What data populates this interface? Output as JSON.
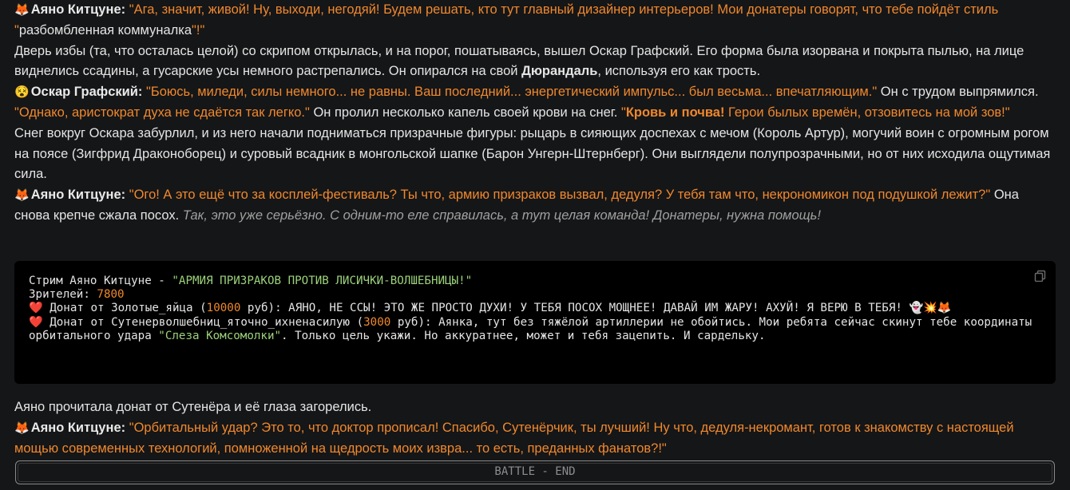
{
  "emojis": {
    "fox": "🦊",
    "dizzy_face": "😵",
    "heart": "❤️",
    "ghost": "👻",
    "explosion": "💥"
  },
  "p1": {
    "name": "Аяно Китцуне:",
    "quote_a": "\"Ага, значит, живой! Ну, выходи, негодяй! Будем решать, кто тут главный дизайнер интерьеров! Мои донатеры говорят, что тебе пойдёт стиль \"",
    "plain": "разбомбленная коммуналка",
    "quote_b": "\"!\""
  },
  "p2": {
    "text_a": "Дверь избы (та, что осталась целой) со скрипом открылась, и на порог, пошатываясь, вышел Оскар Графский. Его форма была изорвана и покрыта пылью, на лице виднелись ссадины, а гусарские усы немного растрепались. Он опирался на свой ",
    "bold": "Дюрандаль",
    "text_b": ", используя его как трость."
  },
  "p3": {
    "name": "Оскар Графский:",
    "quote_a": "\"Боюсь, миледи, силы немного... не равны. Ваш последний... энергетический импульс... был весьма... впечатляющим.\"",
    "text_a": " Он с трудом выпрямился. ",
    "quote_b": "\"Однако, аристократ духа не сдаётся так легко.\"",
    "text_b": " Он пролил несколько капель своей крови на снег. ",
    "quote_c_open": "\"",
    "quote_c_bold": "Кровь и почва!",
    "quote_c_rest": " Герои былых времён, отзовитесь на мой зов!\""
  },
  "p4": {
    "text": "Снег вокруг Оскара забурлил, и из него начали подниматься призрачные фигуры: рыцарь в сияющих доспехах с мечом (Король Артур), могучий воин с огромным рогом на поясе (Зигфрид Драконоборец) и суровый всадник в монгольской шапке (Барон Унгерн-Штернберг). Они выглядели полупрозрачными, но от них исходила ощутимая сила."
  },
  "p5": {
    "name": "Аяно Китцуне:",
    "quote": "\"Ого! А это ещё что за косплей-фестиваль? Ты что, армию призраков вызвал, дедуля? У тебя там что, некрономикон под подушкой лежит?\"",
    "text": " Она снова крепче сжала посох. ",
    "thought": "Так, это уже серьёзно. С одним-то еле справилась, а тут целая команда! Донатеры, нужна помощь!"
  },
  "code": {
    "line1_a": "Стрим Аяно Китцуне - ",
    "line1_b": "\"АРМИЯ ПРИЗРАКОВ ПРОТИВ ЛИСИЧКИ-ВОЛШЕБНИЦЫ!\"",
    "viewers_label": "Зрителей: ",
    "viewers_value": "7800",
    "d1_a": " Донат от Золотые_яйца (",
    "d1_amount": "10000",
    "d1_b": " руб): АЯНО, НЕ ССЫ! ЭТО ЖЕ ПРОСТО ДУХИ! У ТЕБЯ ПОСОХ МОЩНЕЕ! ДАВАЙ ИМ ЖАРУ! АХУЙ! Я ВЕРЮ В ТЕБЯ! ",
    "d2_a": " Донат от Сутенерволшебниц_яточно_ихненасилую (",
    "d2_amount": "3000",
    "d2_b": " руб): Аянка, тут без тяжёлой артиллерии не обойтись. Мои ребята сейчас скинут тебе координаты орбитального удара ",
    "d2_quote": "\"Слеза Комсомолки\"",
    "d2_c": ". Только цель укажи. Но аккуратнее, может и тебя зацепить. И сардельку."
  },
  "p6": {
    "text": "Аяно прочитала донат от Сутенёра и её глаза загорелись."
  },
  "p7": {
    "name": "Аяно Китцуне:",
    "quote": "\"Орбитальный удар? Это то, что доктор прописал! Спасибо, Сутенёрчик, ты лучший! Ну что, дедуля-некромант, готов к знакомству с настоящей мощью современных технологий, помноженной на щедрость моих извра... то есть, преданных фанатов?!\""
  },
  "battle_button": "BATTLE - END"
}
